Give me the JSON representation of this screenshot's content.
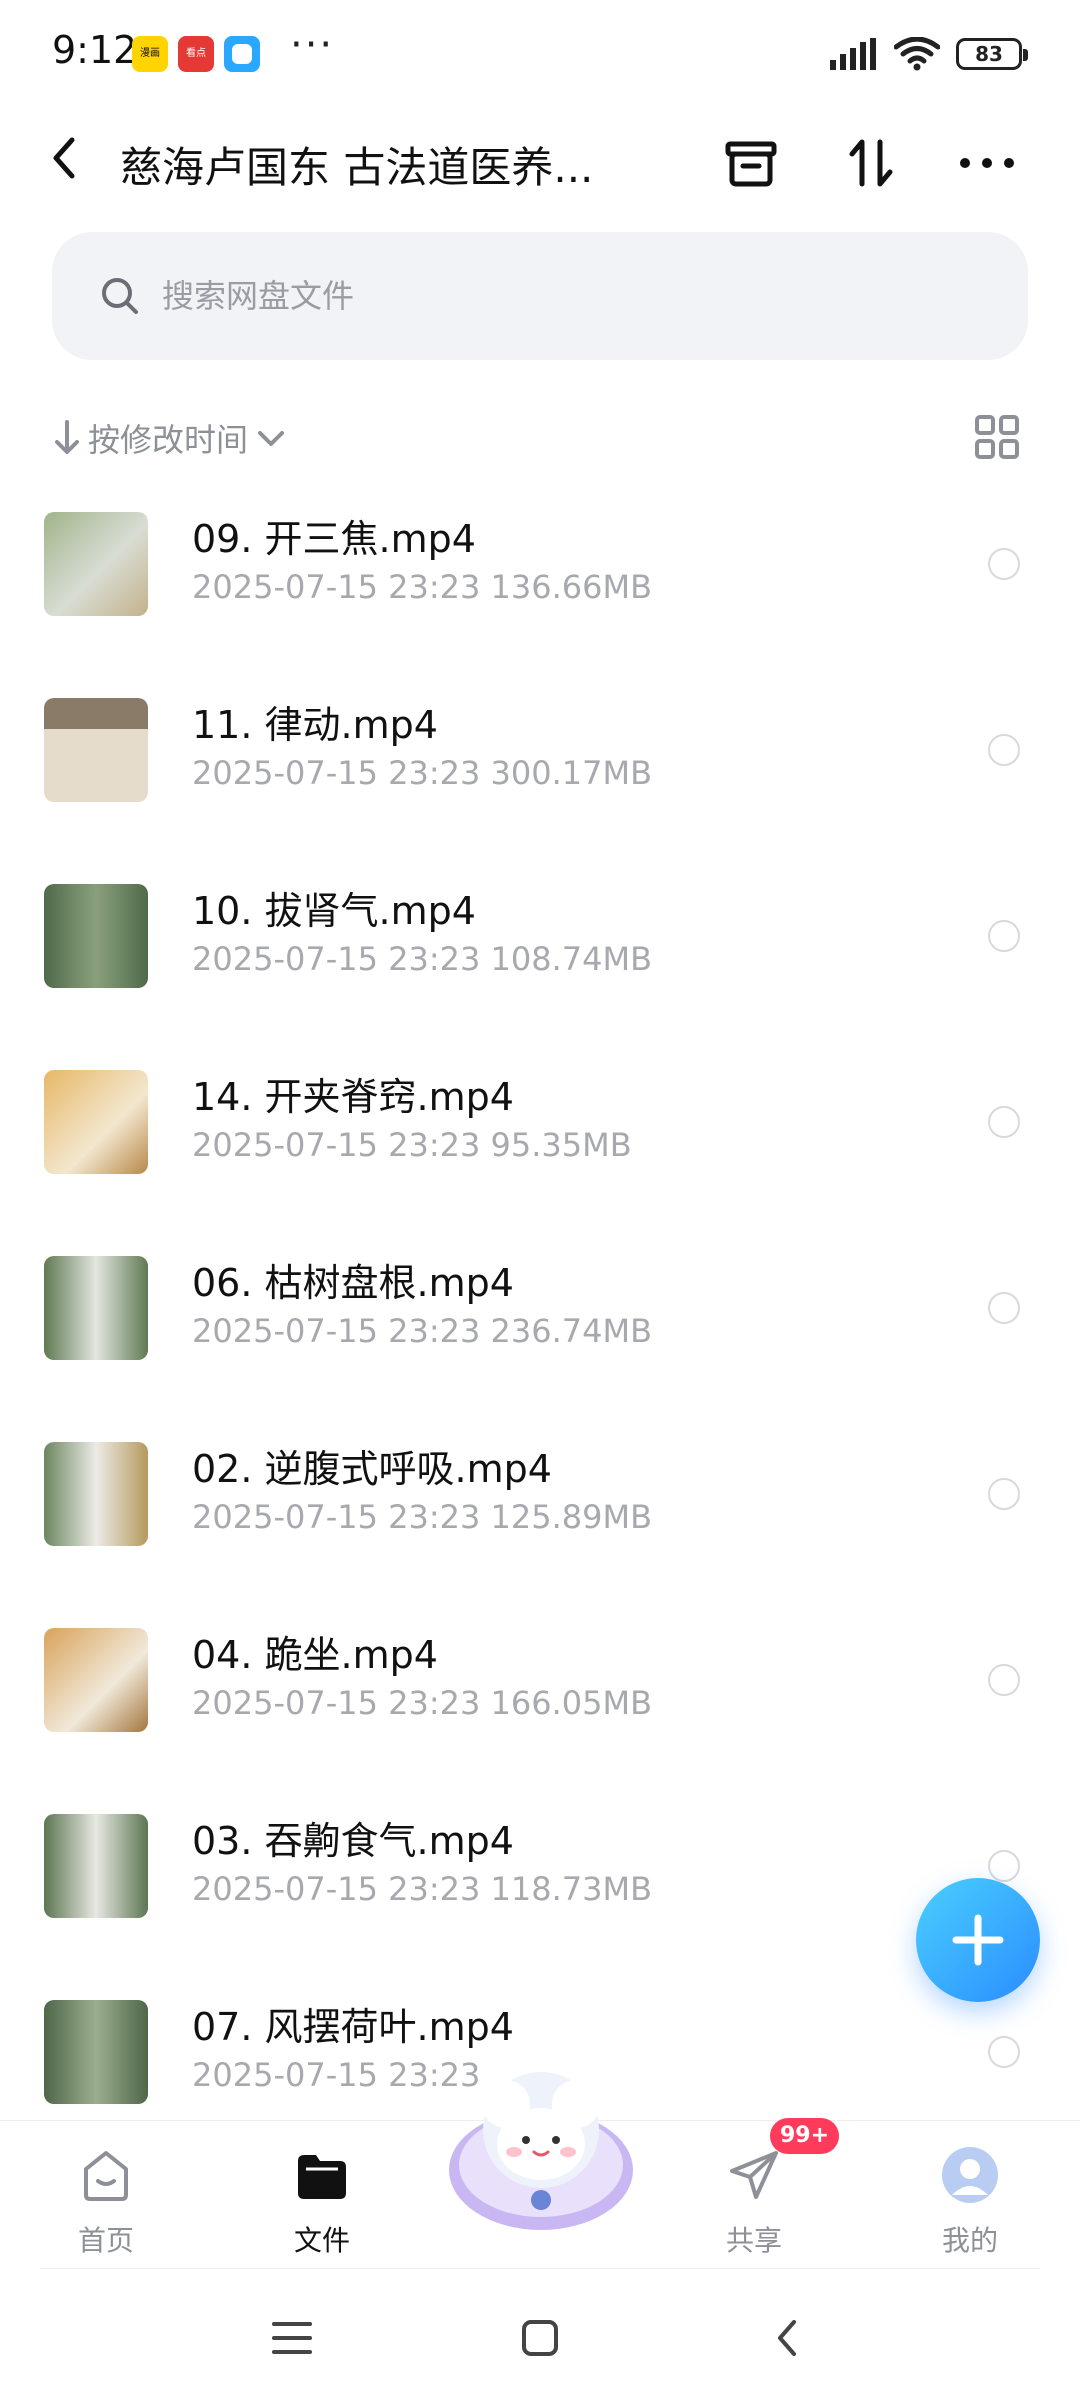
{
  "status_bar": {
    "time": "9:12",
    "apps": [
      {
        "name": "app-icon-1",
        "label": "漫画",
        "color": "#ffd400"
      },
      {
        "name": "app-icon-2",
        "label": "看点",
        "color": "#e53935"
      },
      {
        "name": "app-icon-3",
        "label": "",
        "color": "#2aa8ff"
      }
    ],
    "more": "···",
    "battery": "83"
  },
  "header": {
    "title": "慈海卢国东 古法道医养..."
  },
  "search": {
    "placeholder": "搜索网盘文件"
  },
  "sort": {
    "label": "按修改时间"
  },
  "files": [
    {
      "name": "09.  开三焦.mp4",
      "date": "2025-07-15",
      "time": "23:23",
      "size": "136.66MB",
      "thumb": "#8aa07a"
    },
    {
      "name": "11. 律动.mp4",
      "date": "2025-07-15",
      "time": "23:23",
      "size": "300.17MB",
      "thumb": "#c8b89a"
    },
    {
      "name": "10.  拔肾气.mp4",
      "date": "2025-07-15",
      "time": "23:23",
      "size": "108.74MB",
      "thumb": "#5f7a5a"
    },
    {
      "name": "14.  开夹脊窍.mp4",
      "date": "2025-07-15",
      "time": "23:23",
      "size": "95.35MB",
      "thumb": "#d8a050"
    },
    {
      "name": "06.  枯树盘根.mp4",
      "date": "2025-07-15",
      "time": "23:23",
      "size": "236.74MB",
      "thumb": "#6f8a62"
    },
    {
      "name": "02. 逆腹式呼吸.mp4",
      "date": "2025-07-15",
      "time": "23:23",
      "size": "125.89MB",
      "thumb": "#7a8f6a"
    },
    {
      "name": "04. 跪坐.mp4",
      "date": "2025-07-15",
      "time": "23:23",
      "size": "166.05MB",
      "thumb": "#d9a35a"
    },
    {
      "name": "03. 吞齁食气.mp4",
      "date": "2025-07-15",
      "time": "23:23",
      "size": "118.73MB",
      "thumb": "#6c8560"
    },
    {
      "name": "07.  风摆荷叶.mp4",
      "date": "2025-07-15",
      "time": "23:23",
      "size": "",
      "thumb": "#5b6f55"
    }
  ],
  "bottom_nav": {
    "items": [
      {
        "label": "首页"
      },
      {
        "label": "文件"
      },
      {
        "label": "共享"
      },
      {
        "label": "我的"
      }
    ],
    "share_badge": "99+"
  },
  "colors": {
    "accent": "#2a8cff",
    "badge": "#ff3b5c",
    "muted_text": "#a7a9ae",
    "search_bg": "#f2f3f7"
  }
}
